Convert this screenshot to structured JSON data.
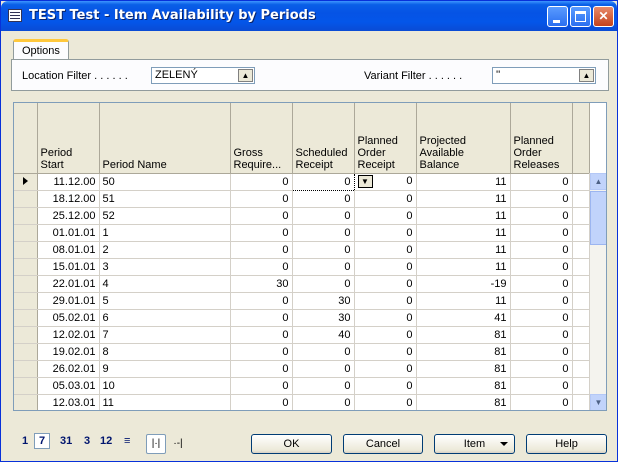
{
  "window": {
    "title": "TEST Test - Item Availability by Periods"
  },
  "tabs": [
    {
      "label": "Options"
    }
  ],
  "filters": {
    "location_label": "Location Filter . . . . . .",
    "location_value": "ZELENÝ",
    "variant_label": "Variant Filter . . . . . .",
    "variant_value": "''"
  },
  "table": {
    "columns": [
      "Period Start",
      "Period Name",
      "Gross Require...",
      "Scheduled Receipt",
      "Planned Order Receipt",
      "Projected Available Balance",
      "Planned Order Releases"
    ],
    "rows": [
      [
        "11.12.00",
        "50",
        "0",
        "0",
        "0",
        "11",
        "0"
      ],
      [
        "18.12.00",
        "51",
        "0",
        "0",
        "0",
        "11",
        "0"
      ],
      [
        "25.12.00",
        "52",
        "0",
        "0",
        "0",
        "11",
        "0"
      ],
      [
        "01.01.01",
        "1",
        "0",
        "0",
        "0",
        "11",
        "0"
      ],
      [
        "08.01.01",
        "2",
        "0",
        "0",
        "0",
        "11",
        "0"
      ],
      [
        "15.01.01",
        "3",
        "0",
        "0",
        "0",
        "11",
        "0"
      ],
      [
        "22.01.01",
        "4",
        "30",
        "0",
        "0",
        "-19",
        "0"
      ],
      [
        "29.01.01",
        "5",
        "0",
        "30",
        "0",
        "11",
        "0"
      ],
      [
        "05.02.01",
        "6",
        "0",
        "30",
        "0",
        "41",
        "0"
      ],
      [
        "12.02.01",
        "7",
        "0",
        "40",
        "0",
        "81",
        "0"
      ],
      [
        "19.02.01",
        "8",
        "0",
        "0",
        "0",
        "81",
        "0"
      ],
      [
        "26.02.01",
        "9",
        "0",
        "0",
        "0",
        "81",
        "0"
      ],
      [
        "05.03.01",
        "10",
        "0",
        "0",
        "0",
        "81",
        "0"
      ],
      [
        "12.03.01",
        "11",
        "0",
        "0",
        "0",
        "81",
        "0"
      ]
    ]
  },
  "period_buttons": [
    "1",
    "7",
    "31",
    "3",
    "12",
    "≡"
  ],
  "buttons": {
    "ok": "OK",
    "cancel": "Cancel",
    "item": "Item",
    "help": "Help"
  }
}
